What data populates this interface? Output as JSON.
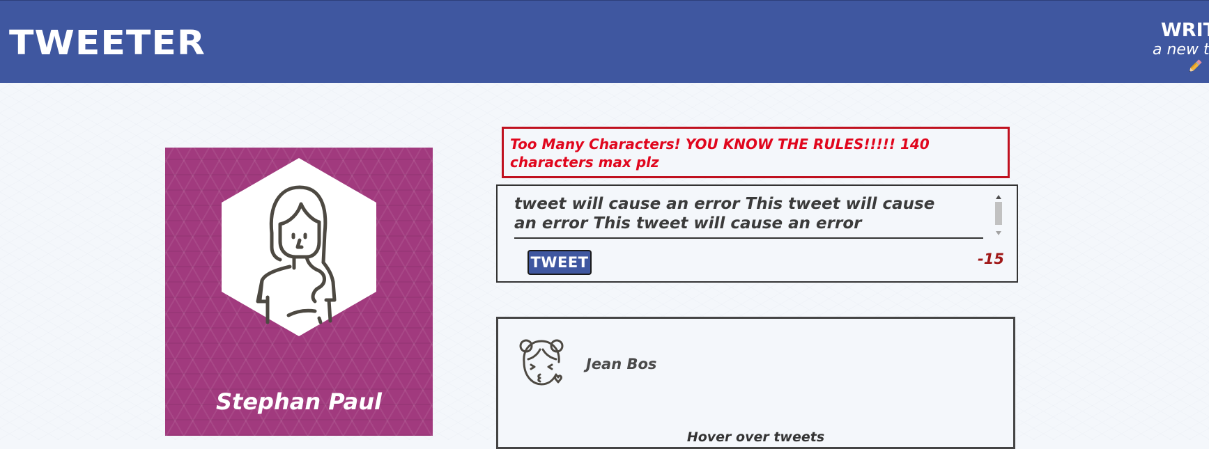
{
  "navbar": {
    "brand": "TWEETER",
    "compose_title": "WRIT",
    "compose_subtitle": "a new tw",
    "compose_icon": "pencil-icon",
    "background_color": "#3f57a0"
  },
  "profile": {
    "name": "Stephan Paul",
    "avatar_icon": "user-avatar-icon",
    "card_color": "#a13a7e"
  },
  "compose": {
    "error_message": "Too Many Characters! YOU KNOW THE RULES!!!!! 140 characters max plz",
    "error_color": "#e0061d",
    "textarea_value": "tweet will cause an error This tweet will cause an error This tweet will cause an error",
    "tweet_button_label": "TWEET",
    "char_counter": "-15",
    "counter_color": "#a01818"
  },
  "tweets": [
    {
      "author": "Jean Bos",
      "avatar_icon": "kissing-face-avatar-icon",
      "content": "Hover over tweets"
    }
  ]
}
